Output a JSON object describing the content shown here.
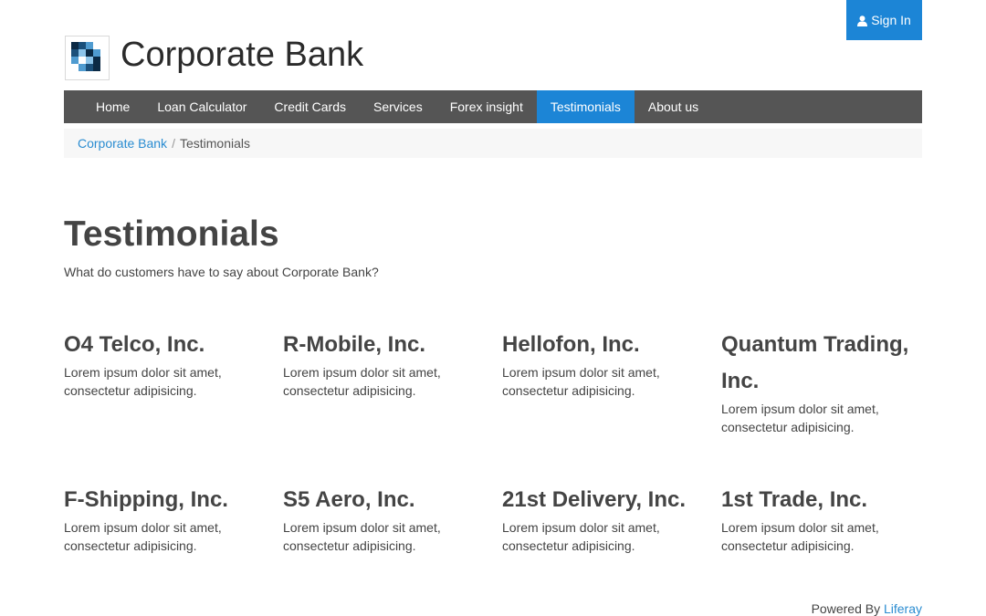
{
  "header": {
    "sign_in_label": "Sign In",
    "site_title": "Corporate Bank"
  },
  "nav": {
    "items": [
      {
        "label": "Home",
        "active": false
      },
      {
        "label": "Loan Calculator",
        "active": false
      },
      {
        "label": "Credit Cards",
        "active": false
      },
      {
        "label": "Services",
        "active": false
      },
      {
        "label": "Forex insight",
        "active": false
      },
      {
        "label": "Testimonials",
        "active": true
      },
      {
        "label": "About us",
        "active": false
      }
    ]
  },
  "breadcrumb": {
    "root": "Corporate Bank",
    "separator": "/",
    "current": "Testimonials"
  },
  "main": {
    "title": "Testimonials",
    "subtitle": "What do customers have to say about Corporate Bank?",
    "testimonials": [
      {
        "company": "O4 Telco, Inc.",
        "text": "Lorem ipsum dolor sit amet, consectetur adipisicing."
      },
      {
        "company": "R-Mobile, Inc.",
        "text": "Lorem ipsum dolor sit amet, consectetur adipisicing."
      },
      {
        "company": "Hellofon, Inc.",
        "text": "Lorem ipsum dolor sit amet, consectetur adipisicing."
      },
      {
        "company": "Quantum Trading, Inc.",
        "text": "Lorem ipsum dolor sit amet, consectetur adipisicing."
      },
      {
        "company": "F-Shipping, Inc.",
        "text": "Lorem ipsum dolor sit amet, consectetur adipisicing."
      },
      {
        "company": "S5 Aero, Inc.",
        "text": "Lorem ipsum dolor sit amet, consectetur adipisicing."
      },
      {
        "company": "21st Delivery, Inc.",
        "text": "Lorem ipsum dolor sit amet, consectetur adipisicing."
      },
      {
        "company": "1st Trade, Inc.",
        "text": "Lorem ipsum dolor sit amet, consectetur adipisicing."
      }
    ]
  },
  "footer": {
    "powered_by": "Powered By",
    "link": "Liferay"
  },
  "colors": {
    "accent": "#1c85d6",
    "nav_bg": "#555555",
    "link": "#2a8cd1"
  },
  "icons": {
    "sign_in": "user-icon",
    "logo": "logo-icon"
  }
}
